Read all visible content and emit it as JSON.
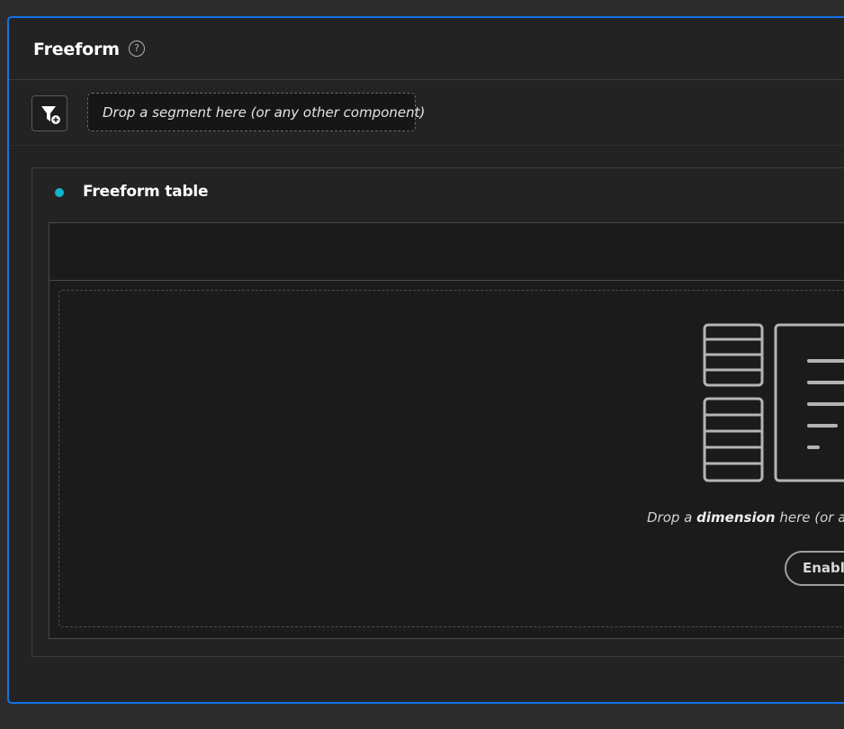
{
  "panel": {
    "title": "Freeform",
    "help_icon": "?"
  },
  "segment_bar": {
    "filter_button_icon": "filter-add-icon",
    "drop_placeholder": "Drop a segment here (or any other component)"
  },
  "visualization": {
    "title": "Freeform table",
    "status_color": "#12b5cb",
    "illustration_icon": "freeform-table-illustration-icon",
    "drop_hint_prefix": "Drop a ",
    "drop_hint_emphasis": "dimension",
    "drop_hint_suffix": " here (or any o",
    "enable_button_label": "Enable"
  },
  "colors": {
    "accent_border": "#1473e6",
    "background": "#232323"
  }
}
